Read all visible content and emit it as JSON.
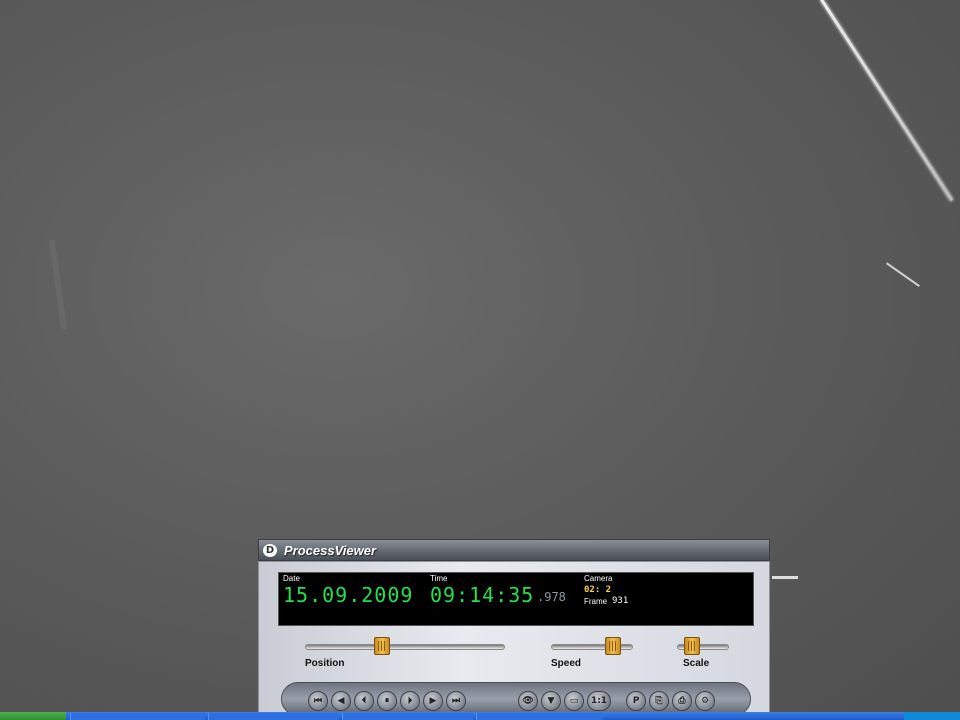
{
  "window": {
    "title": "ProcessViewer",
    "logo": "D"
  },
  "display": {
    "date_label": "Date",
    "date_value": "15.09.2009",
    "time_label": "Time",
    "time_value": "09:14:35",
    "time_ms": ".978",
    "camera_label": "Camera",
    "camera_value": "02: 2",
    "frame_label": "Frame",
    "frame_value": "931",
    "colors": {
      "digits": "#22e24a",
      "camera": "#ffd23a"
    }
  },
  "sliders": {
    "position": {
      "label": "Position",
      "value": 0.38
    },
    "speed": {
      "label": "Speed",
      "value": 0.85
    },
    "scale": {
      "label": "Scale",
      "value": 0.2
    }
  },
  "buttons": [
    {
      "name": "first-frame",
      "glyph": "⏮"
    },
    {
      "name": "rewind",
      "glyph": "◀"
    },
    {
      "name": "step-back",
      "glyph": "⏴"
    },
    {
      "name": "pause",
      "glyph": "⏸"
    },
    {
      "name": "step-forward",
      "glyph": "⏵"
    },
    {
      "name": "play",
      "glyph": "▶"
    },
    {
      "name": "fast-forward",
      "glyph": "⏭"
    },
    {
      "name": "binoculars",
      "glyph": "👁"
    },
    {
      "name": "filter",
      "glyph": "▼"
    },
    {
      "name": "monitor",
      "glyph": "▭"
    },
    {
      "name": "zoom-1-1",
      "glyph": "1:1"
    },
    {
      "name": "parking",
      "glyph": "P"
    },
    {
      "name": "export",
      "glyph": "⎘"
    },
    {
      "name": "print",
      "glyph": "⎙"
    },
    {
      "name": "settings",
      "glyph": "⚙"
    }
  ]
}
